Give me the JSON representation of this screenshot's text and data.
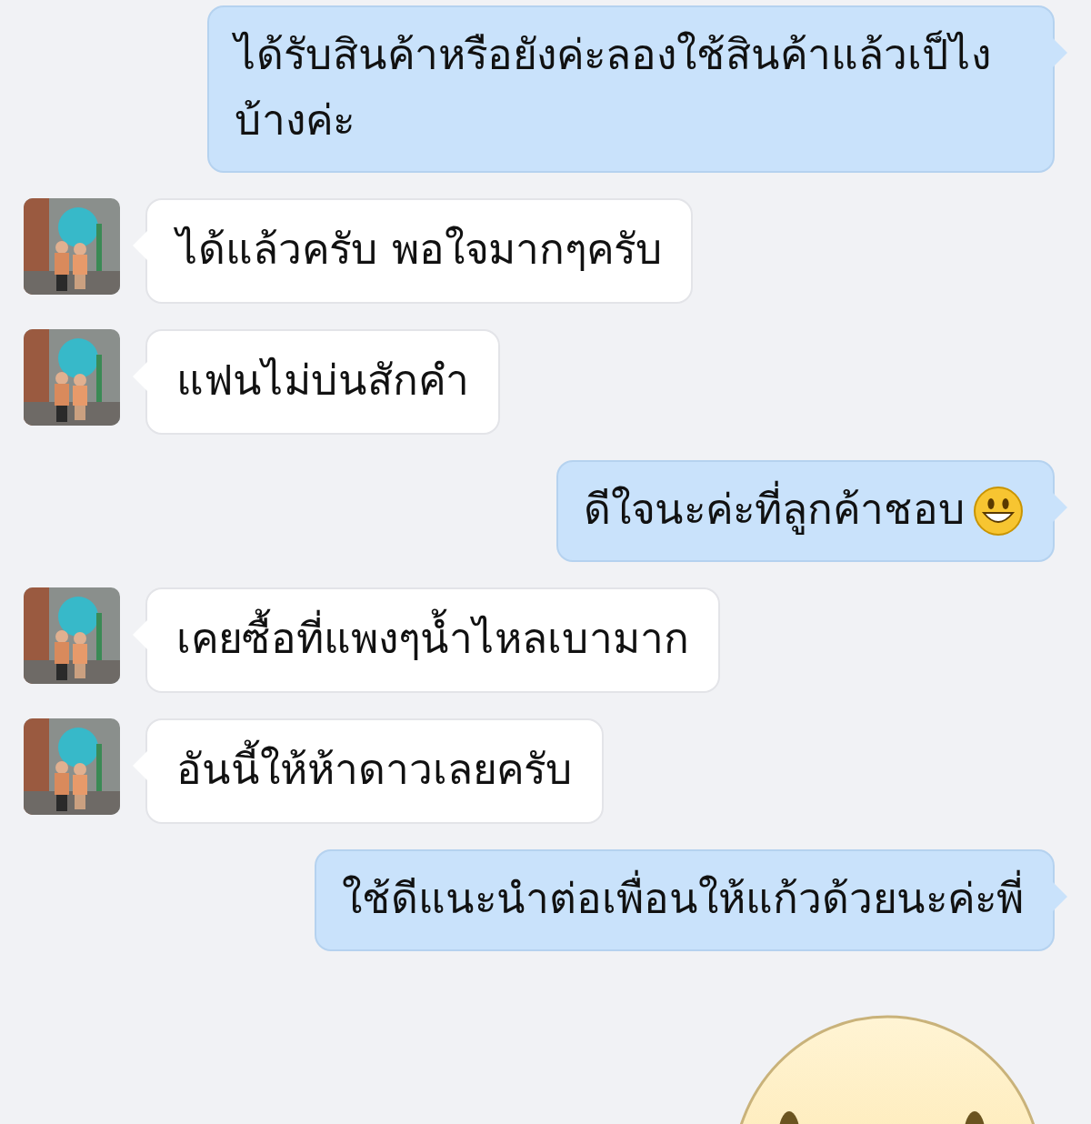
{
  "messages": [
    {
      "kind": "outgoing",
      "text": "ได้รับสินค้าหรือยังค่ะลองใช้สินค้าแล้วเป็ไง บ้างค่ะ"
    },
    {
      "kind": "incoming",
      "text": "ได้แล้วครับ พอใจมากๆครับ"
    },
    {
      "kind": "incoming",
      "text": "แฟนไม่บ่นสักคำ"
    },
    {
      "kind": "outgoing",
      "text": "ดีใจนะค่ะที่ลูกค้าชอบ",
      "emoji": true
    },
    {
      "kind": "incoming",
      "text": "เคยซื้อที่แพงๆน้ำไหลเบามาก"
    },
    {
      "kind": "incoming",
      "text": "อันนี้ให้ห้าดาวเลยครับ"
    },
    {
      "kind": "outgoing",
      "text": "ใช้ดีแนะนำต่อเพื่อนให้แก้วด้วยนะค่ะพี่"
    },
    {
      "kind": "sticker"
    }
  ]
}
